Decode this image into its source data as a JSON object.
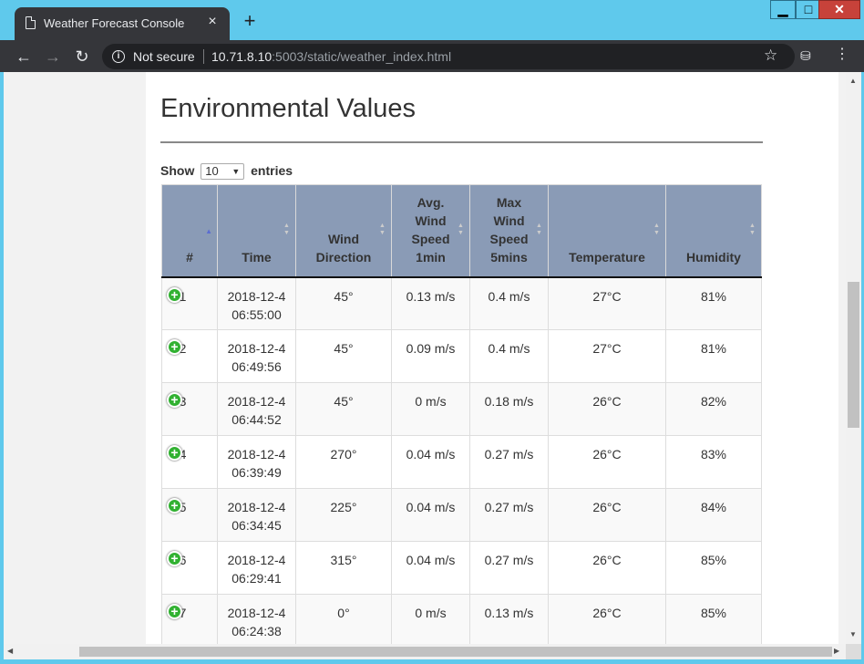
{
  "browser": {
    "tab_title": "Weather Forecast Console",
    "tab_close": "×",
    "new_tab": "+",
    "window_controls": {
      "minimize": "▁",
      "maximize": "□",
      "close": "✕"
    },
    "security_label": "Not secure",
    "url_host": "10.71.8.10",
    "url_path": ":5003/static/weather_index.html",
    "icons": [
      "document-icon",
      "back-icon",
      "forward-icon",
      "reload-icon",
      "info-icon",
      "star-icon",
      "incognito-icon",
      "menu-icon"
    ]
  },
  "page": {
    "heading": "Environmental Values",
    "length_prefix": "Show",
    "length_value": "10",
    "length_suffix": "entries"
  },
  "table": {
    "columns": [
      {
        "label": "#",
        "sorted": "asc"
      },
      {
        "label": "Time"
      },
      {
        "label": "Wind Direction"
      },
      {
        "label": "Avg. Wind Speed 1min"
      },
      {
        "label": "Max Wind Speed 5mins"
      },
      {
        "label": "Temperature"
      },
      {
        "label": "Humidity"
      }
    ],
    "rows": [
      {
        "n": "1",
        "time_date": "2018-12-4",
        "time_clock": "06:55:00",
        "dir": "45°",
        "avg": "0.13 m/s",
        "max": "0.4 m/s",
        "temp": "27°C",
        "hum": "81%"
      },
      {
        "n": "2",
        "time_date": "2018-12-4",
        "time_clock": "06:49:56",
        "dir": "45°",
        "avg": "0.09 m/s",
        "max": "0.4 m/s",
        "temp": "27°C",
        "hum": "81%"
      },
      {
        "n": "3",
        "time_date": "2018-12-4",
        "time_clock": "06:44:52",
        "dir": "45°",
        "avg": "0 m/s",
        "max": "0.18 m/s",
        "temp": "26°C",
        "hum": "82%"
      },
      {
        "n": "4",
        "time_date": "2018-12-4",
        "time_clock": "06:39:49",
        "dir": "270°",
        "avg": "0.04 m/s",
        "max": "0.27 m/s",
        "temp": "26°C",
        "hum": "83%"
      },
      {
        "n": "5",
        "time_date": "2018-12-4",
        "time_clock": "06:34:45",
        "dir": "225°",
        "avg": "0.04 m/s",
        "max": "0.27 m/s",
        "temp": "26°C",
        "hum": "84%"
      },
      {
        "n": "6",
        "time_date": "2018-12-4",
        "time_clock": "06:29:41",
        "dir": "315°",
        "avg": "0.04 m/s",
        "max": "0.27 m/s",
        "temp": "26°C",
        "hum": "85%"
      },
      {
        "n": "7",
        "time_date": "2018-12-4",
        "time_clock": "06:24:38",
        "dir": "0°",
        "avg": "0 m/s",
        "max": "0.13 m/s",
        "temp": "26°C",
        "hum": "85%"
      }
    ]
  },
  "colors": {
    "header_bg": "#8a9bb6",
    "expand_icon": "#31b131",
    "chrome_dark": "#35363a",
    "window_frame": "#5fc9ec"
  }
}
